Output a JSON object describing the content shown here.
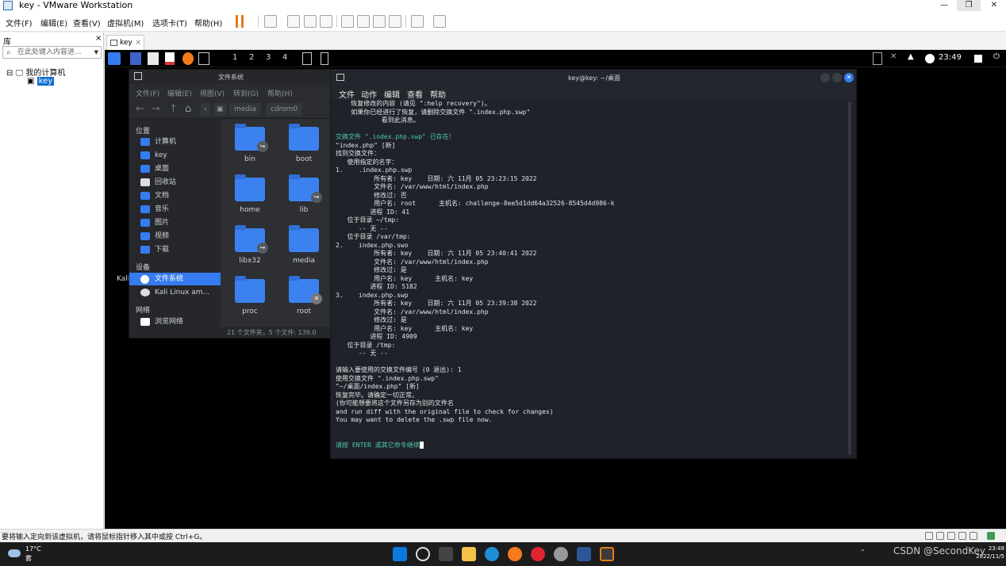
{
  "window": {
    "title": "key - VMware Workstation",
    "controls": [
      "—",
      "❐",
      "✕"
    ]
  },
  "menubar": [
    "文件(F)",
    "编辑(E)",
    "查看(V)",
    "虚拟机(M)",
    "选项卡(T)",
    "帮助(H)"
  ],
  "library": {
    "header": "库",
    "close": "×",
    "search_placeholder": "在此处键入内容进...",
    "root": "我的计算机",
    "child": "key"
  },
  "tab": {
    "label": "key",
    "close": "×"
  },
  "kali": {
    "workspaces": [
      "1",
      "2",
      "3",
      "4"
    ],
    "clock": "23:49"
  },
  "desktop": {
    "icon_label": "Kali"
  },
  "filemanager": {
    "title": "文件系统",
    "menu": [
      "文件(F)",
      "编辑(E)",
      "视图(V)",
      "转到(G)",
      "帮助(H)"
    ],
    "breadcrumbs": [
      "media",
      "cdrom0"
    ],
    "sections": {
      "places": "位置",
      "devices": "设备",
      "network": "网络"
    },
    "places": [
      "计算机",
      "key",
      "桌面",
      "回收站",
      "文档",
      "音乐",
      "图片",
      "视频",
      "下载"
    ],
    "devices": [
      "文件系统",
      "Kali Linux am..."
    ],
    "network": [
      "浏览网络"
    ],
    "folders": [
      "bin",
      "boot",
      "home",
      "lib",
      "libx32",
      "media",
      "proc",
      "root"
    ],
    "status": "21 个文件夹，5 个文件: 139.0"
  },
  "terminal": {
    "title": "key@key: ~/桌面",
    "menu": [
      "文件",
      "动作",
      "编辑",
      "查看",
      "帮助"
    ],
    "lines": [
      "    恢复修改的内容 (请见 \":help recovery\")。",
      "    如果你已经进行了恢复，请删除交换文件 \".index.php.swp\"",
      "            看到此消息。",
      "",
      "交换文件 \".index.php.swp\" 已存在！",
      "\"index.php\" [新]",
      "找到交换文件：",
      "   使用指定的名字：",
      "1.    .index.php.swp",
      "          所有者: key    日期: 六 11月 05 23:23:15 2022",
      "          文件名: /var/www/html/index.php",
      "          修改过: 否",
      "          用户名: root      主机名: challenge-8ee5d1dd64a32526-8545d4d986-k",
      "         进程 ID: 41",
      "   位于目录 ~/tmp:",
      "      -- 无 --",
      "   位于目录 /var/tmp:",
      "2.    index.php.swo",
      "          所有者: key    日期: 六 11月 05 23:40:41 2022",
      "          文件名: /var/www/html/index.php",
      "          修改过: 是",
      "          用户名: key      主机名: key",
      "         进程 ID: 5182",
      "3.    index.php.swp",
      "          所有者: key    日期: 六 11月 05 23:39:38 2022",
      "          文件名: /var/www/html/index.php",
      "          修改过: 是",
      "          用户名: key      主机名: key",
      "         进程 ID: 4909",
      "   位于目录 /tmp:",
      "      -- 无 --",
      "",
      "请输入要使用的交换文件编号 (0 退出): 1",
      "使用交换文件 \".index.php.swp\"",
      "\"~/桌面/index.php\" [新]",
      "恢复完毕。请确定一切正常。",
      "(你可能想要将这个文件另存为别的文件名",
      "and run diff with the original file to check for changes)",
      "You may want to delete the .swp file now.",
      "",
      ""
    ],
    "prompt": "请按 ENTER 或其它命令继续"
  },
  "statusbar": {
    "message": "要将输入定向到该虚拟机，请将鼠标指针移入其中或按 Ctrl+G。"
  },
  "taskbar": {
    "temperature": "17°C",
    "condition": "雾",
    "watermark": "CSDN @SecondKey",
    "time": "23:49",
    "date": "2022/11/5"
  },
  "colors": {
    "kali_accent": "#367bf0",
    "terminal_bg": "#1f2229",
    "terminal_green": "#4ec9b0",
    "vmware_pause": "#e37b18"
  }
}
